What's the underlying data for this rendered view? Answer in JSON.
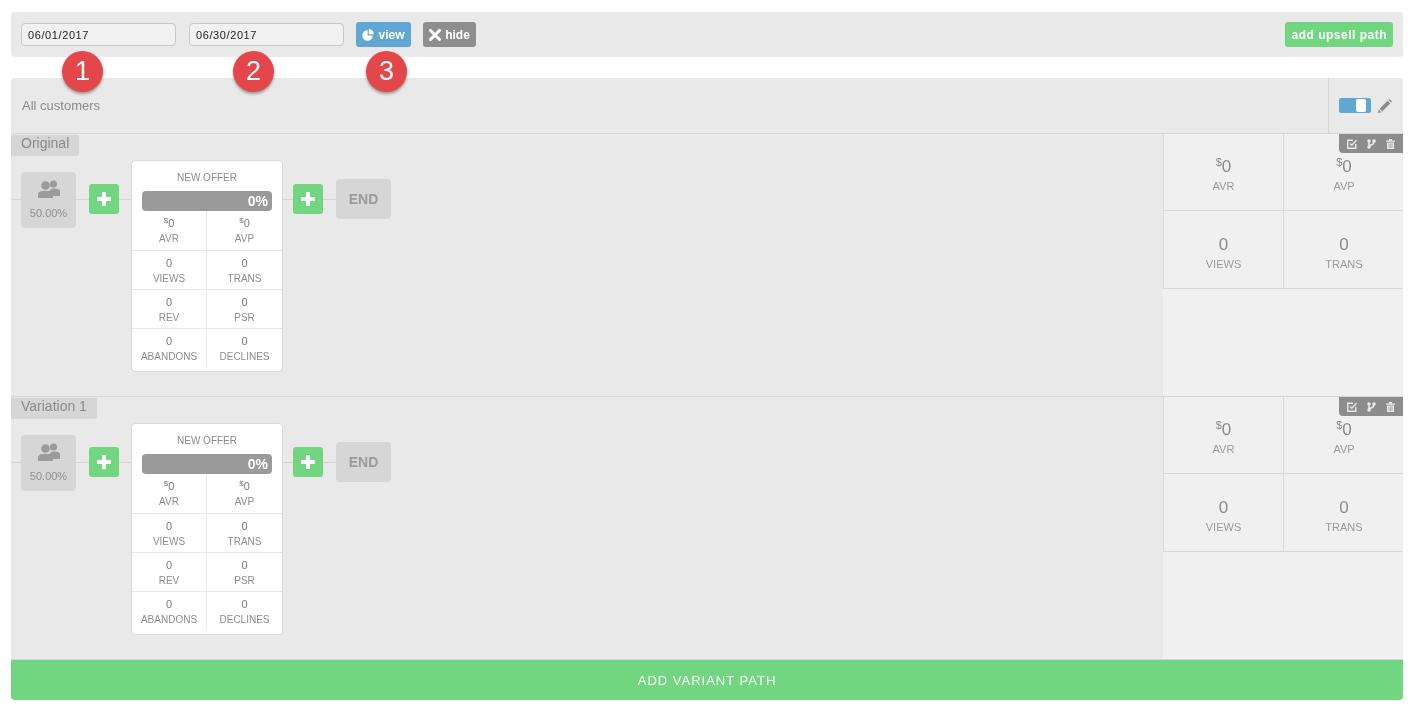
{
  "toolbar": {
    "date_from": {
      "value": "06/01/2017"
    },
    "date_to": {
      "value": "06/30/2017"
    },
    "buttons": [
      {
        "kind": "view",
        "label": "view"
      },
      {
        "kind": "hide",
        "label": "hide"
      }
    ],
    "add_upsell_button": "add upsell path"
  },
  "markers": [
    {
      "label": "1"
    },
    {
      "label": "2"
    },
    {
      "label": "3"
    }
  ],
  "segment": {
    "title": "All customers",
    "toggle_on": true
  },
  "variants": [
    {
      "name": "Original",
      "audience_share": "50.00%",
      "steps": [
        {
          "title": "NEW OFFER",
          "rate": "0%",
          "metrics": [
            {
              "currency": "$",
              "value": "0",
              "label": "AVR"
            },
            {
              "currency": "$",
              "value": "0",
              "label": "AVP"
            },
            {
              "value": "0",
              "label": "VIEWS"
            },
            {
              "value": "0",
              "label": "TRANS"
            },
            {
              "value": "0",
              "label": "REV"
            },
            {
              "value": "0",
              "label": "PSR"
            },
            {
              "value": "0",
              "label": "ABANDONS"
            },
            {
              "value": "0",
              "label": "DECLINES"
            }
          ]
        }
      ],
      "end_label": "END",
      "summary": [
        {
          "currency": "$",
          "value": "0",
          "label": "AVR"
        },
        {
          "currency": "$",
          "value": "0",
          "label": "AVP"
        },
        {
          "value": "0",
          "label": "VIEWS"
        },
        {
          "value": "0",
          "label": "TRANS"
        }
      ]
    },
    {
      "name": "Variation 1",
      "audience_share": "50.00%",
      "steps": [
        {
          "title": "NEW OFFER",
          "rate": "0%",
          "metrics": [
            {
              "currency": "$",
              "value": "0",
              "label": "AVR"
            },
            {
              "currency": "$",
              "value": "0",
              "label": "AVP"
            },
            {
              "value": "0",
              "label": "VIEWS"
            },
            {
              "value": "0",
              "label": "TRANS"
            },
            {
              "value": "0",
              "label": "REV"
            },
            {
              "value": "0",
              "label": "PSR"
            },
            {
              "value": "0",
              "label": "ABANDONS"
            },
            {
              "value": "0",
              "label": "DECLINES"
            }
          ]
        }
      ],
      "end_label": "END",
      "summary": [
        {
          "currency": "$",
          "value": "0",
          "label": "AVR"
        },
        {
          "currency": "$",
          "value": "0",
          "label": "AVP"
        },
        {
          "value": "0",
          "label": "VIEWS"
        },
        {
          "value": "0",
          "label": "TRANS"
        }
      ]
    }
  ],
  "add_variant_button": "ADD VARIANT PATH"
}
